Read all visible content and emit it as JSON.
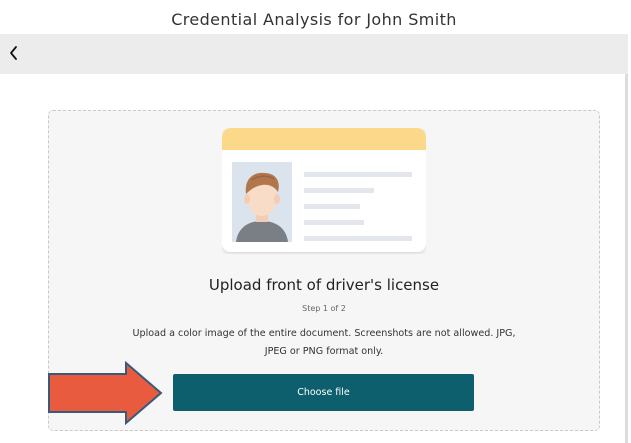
{
  "window": {
    "title": "Credential Analysis for John Smith"
  },
  "nav": {
    "back_icon": "chevron-left-icon"
  },
  "upload": {
    "title": "Upload front of driver's license",
    "step": "Step 1 of 2",
    "instructions": "Upload a color image of the entire document. Screenshots are not allowed. JPG, JPEG or PNG format only.",
    "button_label": "Choose file"
  },
  "illustration": {
    "icon": "drivers-license-icon",
    "header_color": "#fcd88a",
    "photo_bg_color": "#dbe4ec"
  },
  "colors": {
    "button": "#0e5f6e",
    "annotation_arrow": "#e85b3f"
  }
}
